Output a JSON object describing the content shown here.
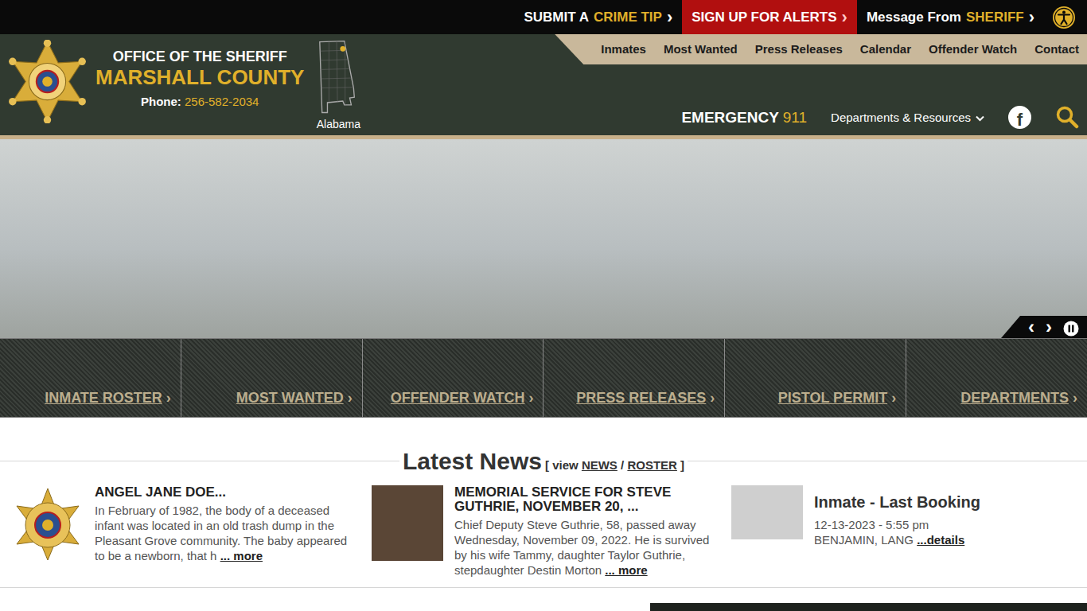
{
  "top_bar": {
    "links": [
      {
        "kind": "link",
        "parts": [
          {
            "text": "SUBMIT A",
            "accent": false
          },
          {
            "text": "CRIME TIP",
            "accent": true
          }
        ],
        "arrow": "›"
      },
      {
        "kind": "alert",
        "parts": [
          {
            "text": "SIGN UP FOR ALERTS",
            "accent": false
          }
        ],
        "arrow": "›"
      },
      {
        "kind": "link",
        "parts": [
          {
            "text": "Message From",
            "accent": false
          },
          {
            "text": "SHERIFF",
            "accent": true
          }
        ],
        "arrow": "›"
      }
    ]
  },
  "header": {
    "title": "OFFICE OF THE SHERIFF",
    "county": "MARSHALL COUNTY",
    "phone_label": "Phone:",
    "phone": "256-582-2034",
    "state": "Alabama"
  },
  "nav": [
    "Inmates",
    "Most Wanted",
    "Press Releases",
    "Calendar",
    "Offender Watch",
    "Contact"
  ],
  "utility": {
    "emergency_label": "EMERGENCY",
    "emergency_number": "911",
    "departments": "Departments & Resources",
    "facebook": "f"
  },
  "slider": {
    "prev": "‹",
    "next": "›",
    "playing": true
  },
  "tiles": [
    {
      "label": "INMATE ROSTER",
      "arrow": "›"
    },
    {
      "label": "MOST WANTED",
      "arrow": "›"
    },
    {
      "label": "OFFENDER WATCH",
      "arrow": "›"
    },
    {
      "label": "PRESS RELEASES",
      "arrow": "›"
    },
    {
      "label": "PISTOL PERMIT",
      "arrow": "›"
    },
    {
      "label": "DEPARTMENTS",
      "arrow": "›"
    }
  ],
  "latest_news": {
    "heading": "Latest News",
    "open": "[",
    "view": "view",
    "news": "NEWS",
    "sep": "/",
    "roster": "ROSTER",
    "close": "]"
  },
  "news": [
    {
      "kind": "badge",
      "title": "ANGEL JANE DOE...",
      "body": "In February of 1982, the body of a deceased infant was located in an old trash dump in the Pleasant Grove community. The baby appeared to be a newborn, that h",
      "more": "... more"
    },
    {
      "kind": "photo",
      "title": "MEMORIAL SERVICE FOR STEVE GUTHRIE, NOVEMBER 20, ...",
      "body": "Chief Deputy Steve Guthrie, 58, passed away Wednesday, November 09, 2022. He is survived by his wife Tammy, daughter Taylor Guthrie, stepdaughter Destin Morton",
      "more": "... more"
    },
    {
      "kind": "booking",
      "title": "Inmate - Last Booking",
      "body": "12-13-2023 - 5:55 pm",
      "name": "BENJAMIN, LANG",
      "more": "...details"
    }
  ]
}
